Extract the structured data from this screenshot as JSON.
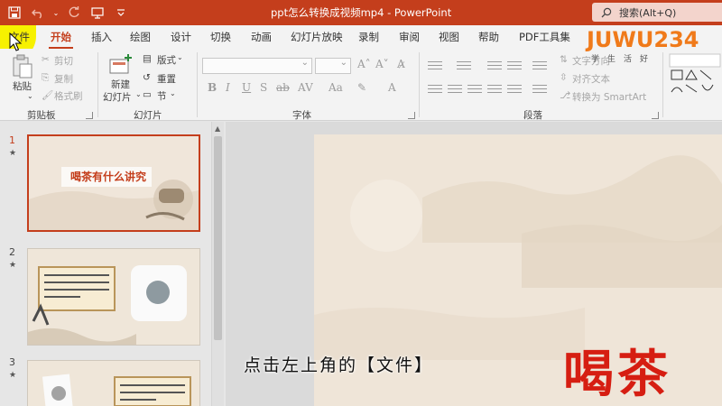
{
  "window": {
    "title": "ppt怎么转换成视频mp4  -  PowerPoint"
  },
  "search": {
    "placeholder": "搜索(Alt+Q)"
  },
  "tabs": [
    {
      "label": "文件"
    },
    {
      "label": "开始",
      "active": true
    },
    {
      "label": "插入"
    },
    {
      "label": "绘图"
    },
    {
      "label": "设计"
    },
    {
      "label": "切换"
    },
    {
      "label": "动画"
    },
    {
      "label": "幻灯片放映"
    },
    {
      "label": "录制"
    },
    {
      "label": "审阅"
    },
    {
      "label": "视图"
    },
    {
      "label": "帮助"
    },
    {
      "label": "PDF工具集"
    }
  ],
  "ribbon": {
    "clipboard": {
      "paste": "粘贴",
      "cut": "剪切",
      "copy": "复制",
      "format_painter": "格式刷",
      "group": "剪贴板"
    },
    "slides": {
      "new_slide_1": "新建",
      "new_slide_2": "幻灯片",
      "layout": "版式",
      "reset": "重置",
      "section": "节",
      "group": "幻灯片"
    },
    "font": {
      "group": "字体"
    },
    "paragraph": {
      "text_direction": "文字方向",
      "align_text": "对齐文本",
      "smartart": "转换为 SmartArt",
      "group": "段落"
    }
  },
  "slides": [
    {
      "number": "1",
      "title": "喝茶有什么讲究"
    },
    {
      "number": "2"
    },
    {
      "number": "3"
    }
  ],
  "main_slide": {
    "title": "喝茶"
  },
  "subtitle": "点击左上角的【文件】",
  "watermark": {
    "logo": "JUWU234",
    "sub": "学生活好"
  },
  "colors": {
    "accent": "#c43e1c",
    "title_red": "#d61e12",
    "highlight": "#f7f100"
  }
}
